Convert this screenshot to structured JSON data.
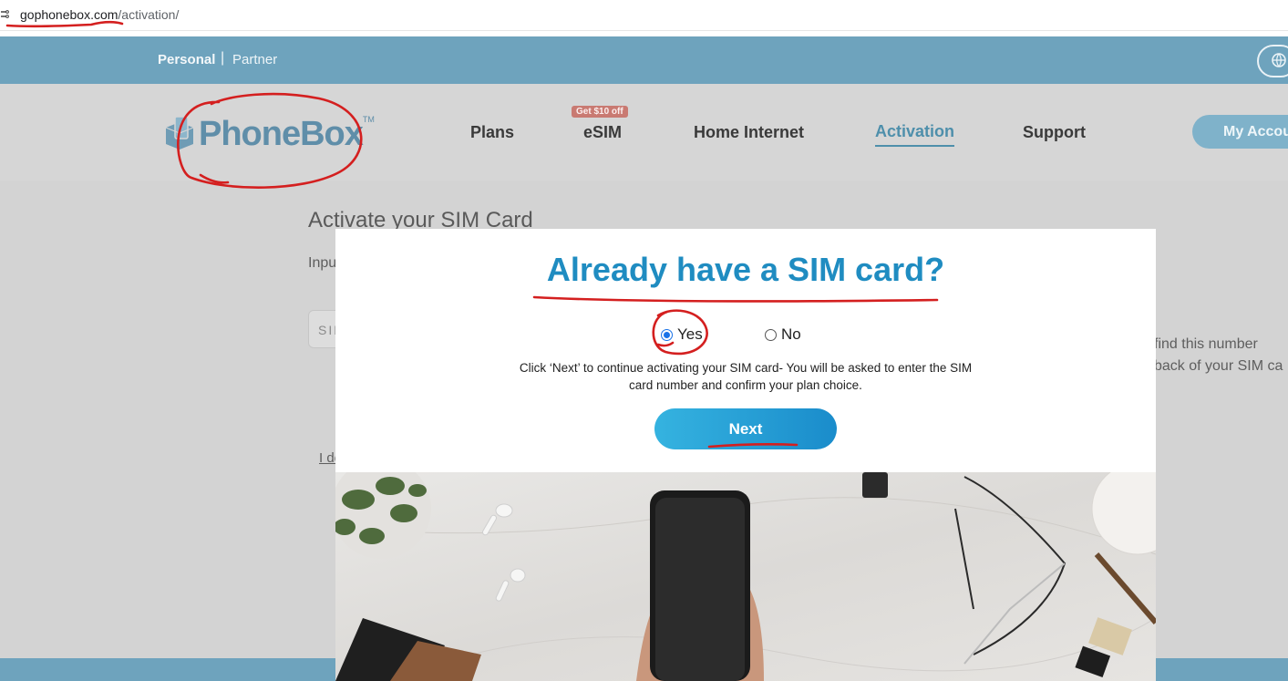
{
  "browser": {
    "url_domain": "gophonebox.com",
    "url_path": "/activation/"
  },
  "topbar": {
    "personal": "Personal",
    "separator": "|",
    "partner": "Partner"
  },
  "nav": {
    "logo_text": "PhoneBox",
    "logo_tm": "TM",
    "items": [
      "Plans",
      "eSIM",
      "Home Internet",
      "Activation",
      "Support"
    ],
    "esim_badge": "Get $10 off",
    "account_button": "My Account"
  },
  "page": {
    "heading": "Activate your SIM Card",
    "input_label": "Inpu",
    "sim_placeholder": "SIM",
    "helper_line1": "find this number",
    "helper_line2": "back of your SIM ca",
    "link_text": "I de"
  },
  "modal": {
    "title": "Already have a SIM card?",
    "option_yes": "Yes",
    "option_no": "No",
    "selected": "Yes",
    "description": "Click ‘Next’ to continue activating your SIM card- You will be asked to enter the SIM card number and confirm your plan choice.",
    "next_button": "Next"
  },
  "colors": {
    "brand_blue": "#1f8cc1",
    "annotation_red": "#d41f1f"
  }
}
